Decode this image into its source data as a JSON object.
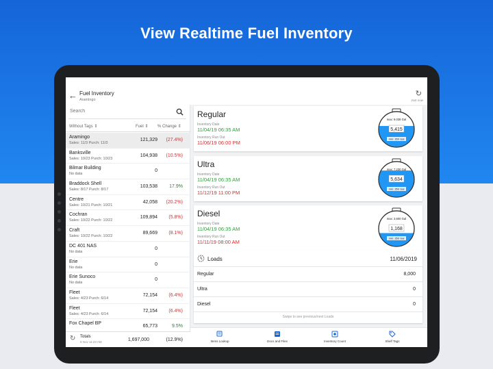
{
  "hero": {
    "title": "View Realtime Fuel Inventory"
  },
  "appbar": {
    "title": "Fuel Inventory",
    "subtitle": "Aramingo",
    "refresh_label": "Just now"
  },
  "search": {
    "placeholder": "Search"
  },
  "list_header": {
    "tags": "Without Tags ⇕",
    "fuel": "Fuel ⇕",
    "change": "% Change ⇕"
  },
  "stations": [
    {
      "name": "Aramingo",
      "sub": "Sales: 11/3  Purch: 11/3",
      "fuel": "121,329",
      "change": "(27.4%)",
      "trend": "neg",
      "selected": true
    },
    {
      "name": "Banksville",
      "sub": "Sales: 10/23  Purch: 10/23",
      "fuel": "104,938",
      "change": "(10.5%)",
      "trend": "neg"
    },
    {
      "name": "Bilmar Building",
      "sub": "No data",
      "fuel": "0",
      "change": "",
      "trend": ""
    },
    {
      "name": "Braddock Shell",
      "sub": "Sales: 8/17  Purch: 8/17",
      "fuel": "103,538",
      "change": "17.9%",
      "trend": "pos"
    },
    {
      "name": "Centre",
      "sub": "Sales: 10/21  Purch: 10/21",
      "fuel": "42,058",
      "change": "(20.2%)",
      "trend": "neg"
    },
    {
      "name": "Cochran",
      "sub": "Sales: 10/22  Purch: 10/22",
      "fuel": "109,894",
      "change": "(5.8%)",
      "trend": "neg"
    },
    {
      "name": "Craft",
      "sub": "Sales: 10/22  Purch: 10/22",
      "fuel": "89,669",
      "change": "(8.1%)",
      "trend": "neg"
    },
    {
      "name": "DC 401  NAS",
      "sub": "No data",
      "fuel": "0",
      "change": "",
      "trend": ""
    },
    {
      "name": "Erie",
      "sub": "No data",
      "fuel": "0",
      "change": "",
      "trend": ""
    },
    {
      "name": "Erie Sunoco",
      "sub": "No data",
      "fuel": "0",
      "change": "",
      "trend": ""
    },
    {
      "name": "Fleet",
      "sub": "Sales: 4/23  Purch: 6/14",
      "fuel": "72,154",
      "change": "(6.4%)",
      "trend": "neg"
    },
    {
      "name": "Fleet",
      "sub": "Sales: 4/23  Purch: 6/14",
      "fuel": "72,154",
      "change": "(6.4%)",
      "trend": "neg"
    },
    {
      "name": "Fox Chapel BP",
      "sub": "",
      "fuel": "65,773",
      "change": "9.5%",
      "trend": "pos"
    }
  ],
  "totals": {
    "label": "Totals",
    "sub": "5 Nov 11:23 AM",
    "fuel": "1,697,000",
    "change": "(12.9%)"
  },
  "fuels": [
    {
      "name": "Regular",
      "inv_label": "Inventory Date",
      "inv_date": "11/04/19 06:35 AM",
      "run_label": "Inventory Run Out",
      "run_date": "11/06/19 06:00 PM",
      "max": "max: 9,038 Gal",
      "value": "5,415",
      "min": "min: 350 Gal",
      "level": 0.59
    },
    {
      "name": "Ultra",
      "inv_label": "Inventory Date",
      "inv_date": "11/04/19 06:35 AM",
      "run_label": "Inventory Run Out",
      "run_date": "11/12/19 11:00 PM",
      "max": "max: 7,230 Gal",
      "value": "5,634",
      "min": "min: 350 Gal",
      "level": 0.77
    },
    {
      "name": "Diesel",
      "inv_label": "Inventory Date",
      "inv_date": "11/04/19 06:35 AM",
      "run_label": "Inventory Run Out",
      "run_date": "11/11/19 08:00 AM",
      "max": "max: 3,600 Gal",
      "value": "1,168",
      "min": "min: 350 Gal",
      "level": 0.33
    }
  ],
  "loads": {
    "title": "Loads",
    "date": "11/06/2019",
    "rows": [
      {
        "name": "Regular",
        "value": "8,000"
      },
      {
        "name": "Ultra",
        "value": "0"
      },
      {
        "name": "Diesel",
        "value": "0"
      }
    ],
    "hint": "Swipe to see previous/next Loads"
  },
  "nav": [
    {
      "label": "Items Lookup",
      "icon": "items-lookup-icon"
    },
    {
      "label": "Docs and Files",
      "icon": "docs-files-icon"
    },
    {
      "label": "Inventory Count",
      "icon": "inventory-count-icon"
    },
    {
      "label": "Shelf Tags",
      "icon": "shelf-tags-icon"
    }
  ],
  "colors": {
    "hero_blue": "#1565d8",
    "tank_blue": "#2196f3",
    "positive": "#2e7d32",
    "negative": "#d32f2f",
    "date_green": "#2e9e3a"
  }
}
